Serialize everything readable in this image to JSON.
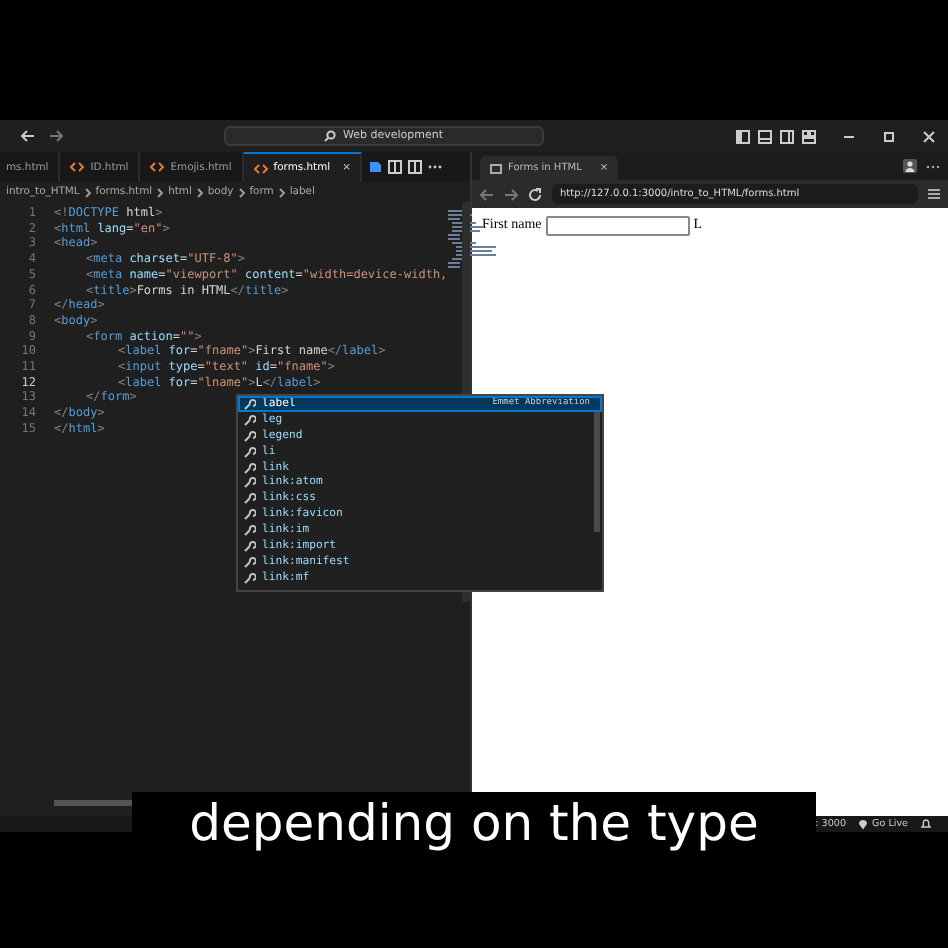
{
  "title_bar": {
    "search": "Web development"
  },
  "editor_tabs": [
    {
      "label": "ms.html",
      "selected": false
    },
    {
      "label": "ID.html",
      "selected": false
    },
    {
      "label": "Emojis.html",
      "selected": false
    },
    {
      "label": "forms.html",
      "selected": true,
      "close": "×"
    }
  ],
  "breadcrumb": [
    "intro_to_HTML",
    "forms.html",
    "html",
    "body",
    "form",
    "label"
  ],
  "code": [
    {
      "n": "1",
      "tokens": [
        {
          "kind": "b",
          "text": "<!"
        },
        {
          "kind": "tag",
          "text": "DOCTYPE"
        },
        {
          "kind": "text",
          "text": " html"
        },
        {
          "kind": "b",
          "text": ">"
        }
      ]
    },
    {
      "n": "2",
      "tokens": [
        {
          "kind": "b",
          "text": "<"
        },
        {
          "kind": "tag",
          "text": "html"
        },
        {
          "kind": "attr",
          "text": " lang"
        },
        {
          "kind": "text",
          "text": "="
        },
        {
          "kind": "str",
          "text": "\"en\""
        },
        {
          "kind": "b",
          "text": ">"
        }
      ]
    },
    {
      "n": "3",
      "tokens": [
        {
          "kind": "b",
          "text": "<"
        },
        {
          "kind": "tag",
          "text": "head"
        },
        {
          "kind": "b",
          "text": ">"
        }
      ],
      "children": [
        {
          "n": "4",
          "tokens": [
            {
              "kind": "b",
              "text": "<"
            },
            {
              "kind": "tag",
              "text": "meta"
            },
            {
              "kind": "attr",
              "text": " charset"
            },
            {
              "kind": "text",
              "text": "="
            },
            {
              "kind": "str",
              "text": "\"UTF-8\""
            },
            {
              "kind": "b",
              "text": ">"
            }
          ]
        },
        {
          "n": "5",
          "tokens": [
            {
              "kind": "b",
              "text": "<"
            },
            {
              "kind": "tag",
              "text": "meta"
            },
            {
              "kind": "attr",
              "text": " name"
            },
            {
              "kind": "text",
              "text": "="
            },
            {
              "kind": "str",
              "text": "\"viewport\""
            },
            {
              "kind": "attr",
              "text": " content"
            },
            {
              "kind": "text",
              "text": "="
            },
            {
              "kind": "str",
              "text": "\"width=device-width,"
            }
          ]
        },
        {
          "n": "6",
          "tokens": [
            {
              "kind": "b",
              "text": "<"
            },
            {
              "kind": "tag",
              "text": "title"
            },
            {
              "kind": "b",
              "text": ">"
            },
            {
              "kind": "text",
              "text": "Forms in HTML"
            },
            {
              "kind": "b",
              "text": "</"
            },
            {
              "kind": "tag",
              "text": "title"
            },
            {
              "kind": "b",
              "text": ">"
            }
          ]
        }
      ]
    },
    {
      "n": "7",
      "tokens": [
        {
          "kind": "b",
          "text": "</"
        },
        {
          "kind": "tag",
          "text": "head"
        },
        {
          "kind": "b",
          "text": ">"
        }
      ]
    },
    {
      "n": "8",
      "tokens": [
        {
          "kind": "b",
          "text": "<"
        },
        {
          "kind": "tag",
          "text": "body"
        },
        {
          "kind": "b",
          "text": ">"
        }
      ],
      "children": [
        {
          "n": "9",
          "tokens": [
            {
              "kind": "b",
              "text": "<"
            },
            {
              "kind": "tag",
              "text": "form"
            },
            {
              "kind": "attr",
              "text": " action"
            },
            {
              "kind": "text",
              "text": "="
            },
            {
              "kind": "str",
              "text": "\"\""
            },
            {
              "kind": "b",
              "text": ">"
            }
          ],
          "children": [
            {
              "n": "10",
              "tokens": [
                {
                  "kind": "b",
                  "text": "<"
                },
                {
                  "kind": "tag",
                  "text": "label"
                },
                {
                  "kind": "attr",
                  "text": " for"
                },
                {
                  "kind": "text",
                  "text": "="
                },
                {
                  "kind": "str",
                  "text": "\"fname\""
                },
                {
                  "kind": "b",
                  "text": ">"
                },
                {
                  "kind": "text",
                  "text": "First name"
                },
                {
                  "kind": "b",
                  "text": "</"
                },
                {
                  "kind": "tag",
                  "text": "label"
                },
                {
                  "kind": "b",
                  "text": ">"
                }
              ]
            },
            {
              "n": "11",
              "tokens": [
                {
                  "kind": "b",
                  "text": "<"
                },
                {
                  "kind": "tag",
                  "text": "input"
                },
                {
                  "kind": "attr",
                  "text": " type"
                },
                {
                  "kind": "text",
                  "text": "="
                },
                {
                  "kind": "str",
                  "text": "\"text\""
                },
                {
                  "kind": "attr",
                  "text": " id"
                },
                {
                  "kind": "text",
                  "text": "="
                },
                {
                  "kind": "str",
                  "text": "\"fname\""
                },
                {
                  "kind": "b",
                  "text": ">"
                }
              ]
            },
            {
              "n": "12",
              "current": true,
              "tokens": [
                {
                  "kind": "b",
                  "text": "<"
                },
                {
                  "kind": "tag",
                  "text": "label"
                },
                {
                  "kind": "attr",
                  "text": " for"
                },
                {
                  "kind": "text",
                  "text": "="
                },
                {
                  "kind": "str",
                  "text": "\"lname\""
                },
                {
                  "kind": "b",
                  "text": ">"
                },
                {
                  "kind": "text",
                  "text": "L"
                },
                {
                  "kind": "b",
                  "text": "</"
                },
                {
                  "kind": "tag",
                  "text": "label"
                },
                {
                  "kind": "b",
                  "text": ">"
                }
              ]
            }
          ]
        },
        {
          "n": "13",
          "tokens": [
            {
              "kind": "b",
              "text": "</"
            },
            {
              "kind": "tag",
              "text": "form"
            },
            {
              "kind": "b",
              "text": ">"
            }
          ]
        }
      ]
    },
    {
      "n": "14",
      "tokens": [
        {
          "kind": "b",
          "text": "</"
        },
        {
          "kind": "tag",
          "text": "body"
        },
        {
          "kind": "b",
          "text": ">"
        }
      ]
    },
    {
      "n": "15",
      "tokens": [
        {
          "kind": "b",
          "text": "</"
        },
        {
          "kind": "tag",
          "text": "html"
        },
        {
          "kind": "b",
          "text": ">"
        }
      ]
    }
  ],
  "suggestions": {
    "detail": "Emmet Abbreviation",
    "items": [
      {
        "label": "label",
        "selected": true
      },
      {
        "label": "leg",
        "selected": false
      },
      {
        "label": "legend",
        "selected": false
      },
      {
        "label": "li",
        "selected": false
      },
      {
        "label": "link",
        "selected": false
      },
      {
        "label": "link:atom",
        "selected": false
      },
      {
        "label": "link:css",
        "selected": false
      },
      {
        "label": "link:favicon",
        "selected": false
      },
      {
        "label": "link:im",
        "selected": false
      },
      {
        "label": "link:import",
        "selected": false
      },
      {
        "label": "link:manifest",
        "selected": false
      },
      {
        "label": "link:mf",
        "selected": false
      }
    ]
  },
  "browser": {
    "tab": "Forms in HTML",
    "tab_close": "×",
    "url": "http://127.0.0.1:3000/intro_to_HTML/forms.html",
    "page": {
      "label": "First name",
      "after": "L"
    }
  },
  "status_bar": {
    "port": ": 3000",
    "go_live": "Go Live"
  },
  "subtitle": "depending on the type"
}
